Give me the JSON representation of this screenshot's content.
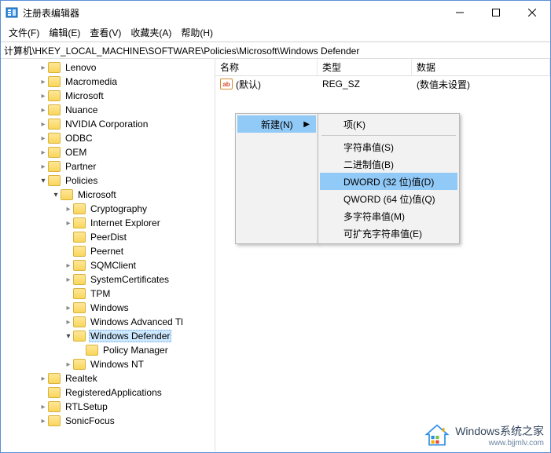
{
  "window": {
    "title": "注册表编辑器"
  },
  "menubar": {
    "file": "文件(F)",
    "edit": "编辑(E)",
    "view": "查看(V)",
    "favorites": "收藏夹(A)",
    "help": "帮助(H)"
  },
  "address": "计算机\\HKEY_LOCAL_MACHINE\\SOFTWARE\\Policies\\Microsoft\\Windows Defender",
  "tree": [
    {
      "depth": 3,
      "exp": "closed",
      "label": "Lenovo"
    },
    {
      "depth": 3,
      "exp": "closed",
      "label": "Macromedia"
    },
    {
      "depth": 3,
      "exp": "closed",
      "label": "Microsoft"
    },
    {
      "depth": 3,
      "exp": "closed",
      "label": "Nuance"
    },
    {
      "depth": 3,
      "exp": "closed",
      "label": "NVIDIA Corporation"
    },
    {
      "depth": 3,
      "exp": "closed",
      "label": "ODBC"
    },
    {
      "depth": 3,
      "exp": "closed",
      "label": "OEM"
    },
    {
      "depth": 3,
      "exp": "closed",
      "label": "Partner"
    },
    {
      "depth": 3,
      "exp": "open",
      "label": "Policies"
    },
    {
      "depth": 4,
      "exp": "open",
      "label": "Microsoft"
    },
    {
      "depth": 5,
      "exp": "closed",
      "label": "Cryptography"
    },
    {
      "depth": 5,
      "exp": "closed",
      "label": "Internet Explorer"
    },
    {
      "depth": 5,
      "exp": "none",
      "label": "PeerDist"
    },
    {
      "depth": 5,
      "exp": "none",
      "label": "Peernet"
    },
    {
      "depth": 5,
      "exp": "closed",
      "label": "SQMClient"
    },
    {
      "depth": 5,
      "exp": "closed",
      "label": "SystemCertificates"
    },
    {
      "depth": 5,
      "exp": "none",
      "label": "TPM"
    },
    {
      "depth": 5,
      "exp": "closed",
      "label": "Windows"
    },
    {
      "depth": 5,
      "exp": "closed",
      "label": "Windows Advanced Tl"
    },
    {
      "depth": 5,
      "exp": "open",
      "label": "Windows Defender",
      "selected": true
    },
    {
      "depth": 6,
      "exp": "none",
      "label": "Policy Manager"
    },
    {
      "depth": 5,
      "exp": "closed",
      "label": "Windows NT"
    },
    {
      "depth": 3,
      "exp": "closed",
      "label": "Realtek"
    },
    {
      "depth": 3,
      "exp": "none",
      "label": "RegisteredApplications"
    },
    {
      "depth": 3,
      "exp": "closed",
      "label": "RTLSetup"
    },
    {
      "depth": 3,
      "exp": "closed",
      "label": "SonicFocus"
    }
  ],
  "columns": {
    "name": "名称",
    "type": "类型",
    "data": "数据"
  },
  "rows": [
    {
      "icon": "ab",
      "name": "(默认)",
      "type": "REG_SZ",
      "data": "(数值未设置)"
    }
  ],
  "contextMenu": {
    "root": [
      {
        "label": "新建(N)",
        "submenu": true,
        "highlight": true
      }
    ],
    "sub": [
      {
        "label": "项(K)"
      },
      {
        "sep": true
      },
      {
        "label": "字符串值(S)"
      },
      {
        "label": "二进制值(B)"
      },
      {
        "label": "DWORD (32 位)值(D)",
        "highlight": true
      },
      {
        "label": "QWORD (64 位)值(Q)"
      },
      {
        "label": "多字符串值(M)"
      },
      {
        "label": "可扩充字符串值(E)"
      }
    ]
  },
  "watermark": {
    "line1": "Windows系统之家",
    "line2": "www.bjjmlv.com"
  }
}
